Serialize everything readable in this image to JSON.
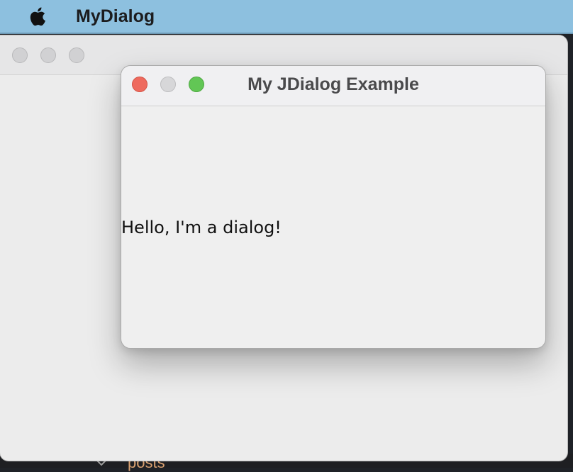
{
  "menubar": {
    "apple_icon": "apple-logo-icon",
    "app_name": "MyDialog"
  },
  "background": {
    "partial_text": "posts",
    "chevron_icon": "chevron-down-icon"
  },
  "main_window": {
    "traffic_lights": [
      "close",
      "minimize",
      "zoom"
    ]
  },
  "dialog": {
    "title": "My JDialog Example",
    "message": "Hello, I'm a dialog!",
    "colors": {
      "close": "#ee6a5e",
      "minimize": "#d7d7d9",
      "zoom": "#62c655"
    }
  }
}
